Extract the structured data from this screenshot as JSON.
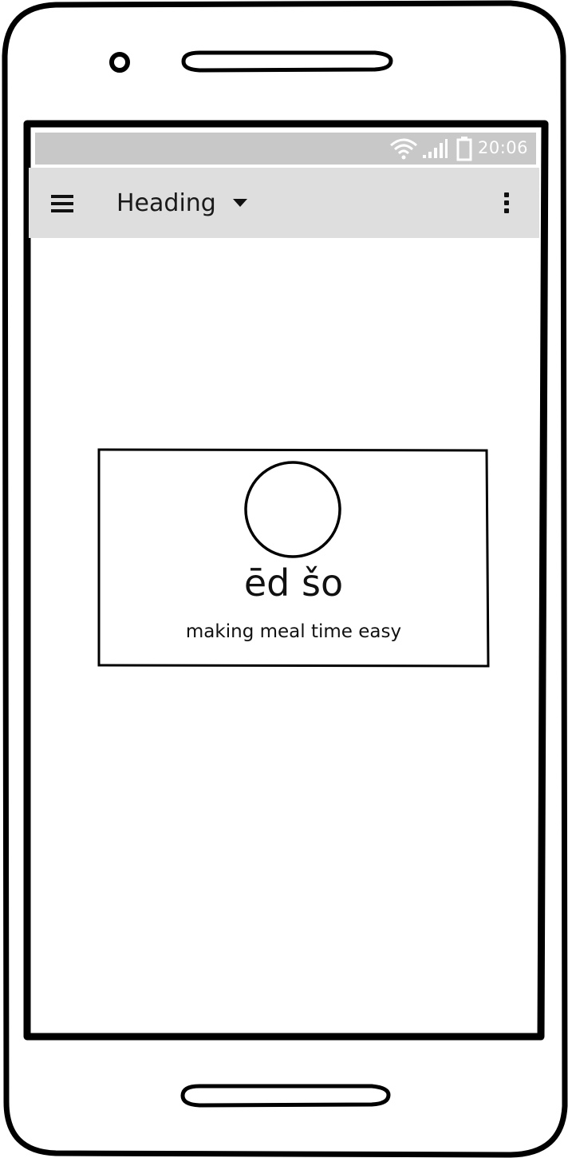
{
  "status_bar": {
    "time": "20:06",
    "icons": [
      "wifi-icon",
      "signal-icon",
      "battery-icon"
    ]
  },
  "app_bar": {
    "title": "Heading",
    "menu_icon": "hamburger-menu-icon",
    "dropdown_icon": "caret-down-icon",
    "overflow_icon": "more-vertical-icon"
  },
  "splash_card": {
    "logo_icon": "circle-logo-icon",
    "brand_name": "ēd šo",
    "tagline": "making meal time easy"
  },
  "colors": {
    "status_bar_bg": "#c8c8c8",
    "app_bar_bg": "#dedede",
    "ink": "#000000"
  }
}
